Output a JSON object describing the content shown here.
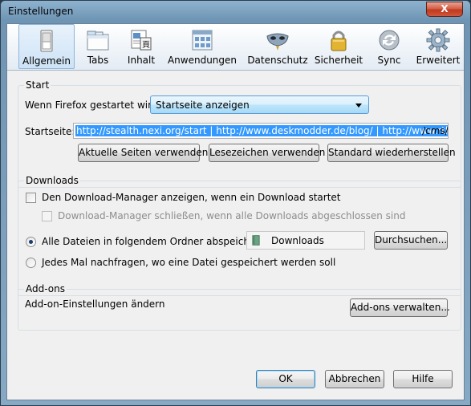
{
  "window": {
    "title": "Einstellungen",
    "close_label": "X"
  },
  "tabs": [
    {
      "label": "Allgemein",
      "icon": "switch-icon",
      "selected": true
    },
    {
      "label": "Tabs",
      "icon": "tabs-window-icon"
    },
    {
      "label": "Inhalt",
      "icon": "content-page-icon"
    },
    {
      "label": "Anwendungen",
      "icon": "applications-icon"
    },
    {
      "label": "Datenschutz",
      "icon": "mask-icon"
    },
    {
      "label": "Sicherheit",
      "icon": "padlock-icon"
    },
    {
      "label": "Sync",
      "icon": "sync-icon"
    },
    {
      "label": "Erweitert",
      "icon": "gear-icon"
    }
  ],
  "start": {
    "group_title": "Start",
    "startup_label": "Wenn Firefox gestartet wird:",
    "startup_value": "Startseite anzeigen",
    "homepage_label": "Startseite:",
    "homepage_selected": "http://stealth.nexi.org/start | http://www.deskmodder.de/blog/ | http://www.rtl.de",
    "homepage_rest": "/cms/",
    "btn_current": "Aktuelle Seiten verwenden",
    "btn_bookmark": "Lesezeichen verwenden",
    "btn_default": "Standard wiederherstellen"
  },
  "downloads": {
    "group_title": "Downloads",
    "show_manager": "Den Download-Manager anzeigen, wenn ein Download startet",
    "close_manager": "Download-Manager schließen, wenn alle Downloads abgeschlossen sind",
    "save_all": "Alle Dateien in folgendem Ordner abspeichern:",
    "folder": "Downloads",
    "browse": "Durchsuchen...",
    "ask_each": "Jedes Mal nachfragen, wo eine Datei gespeichert werden soll"
  },
  "addons": {
    "group_title": "Add-ons",
    "description": "Add-on-Einstellungen ändern",
    "manage": "Add-ons verwalten..."
  },
  "footer": {
    "ok": "OK",
    "cancel": "Abbrechen",
    "help": "Hilfe"
  },
  "colors": {
    "selection": "#3399ff",
    "accent": "#5a9bd6"
  }
}
